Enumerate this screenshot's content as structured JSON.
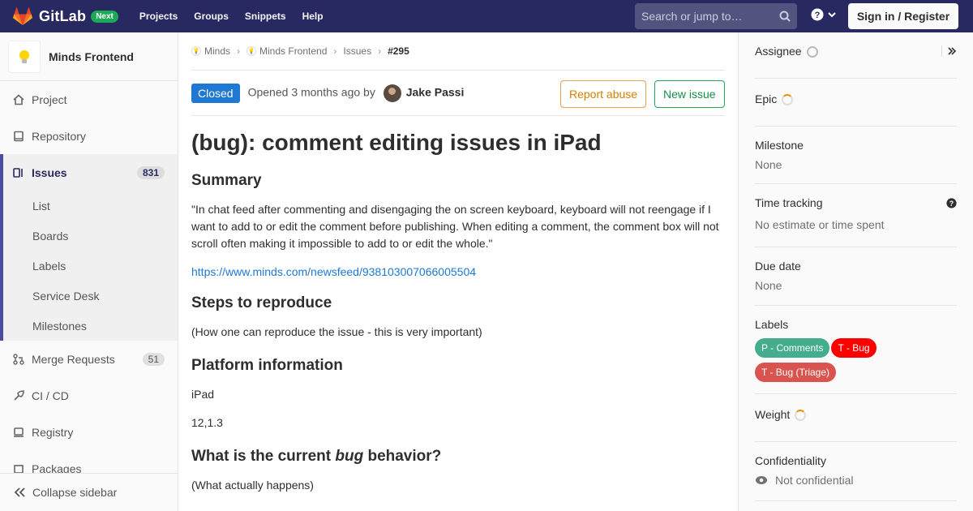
{
  "topbar": {
    "brand": "GitLab",
    "badge": "Next",
    "nav": [
      "Projects",
      "Groups",
      "Snippets",
      "Help"
    ],
    "search_placeholder": "Search or jump to…",
    "signin": "Sign in / Register"
  },
  "sidebar": {
    "project_name": "Minds Frontend",
    "items": [
      {
        "label": "Project",
        "icon": "home-icon"
      },
      {
        "label": "Repository",
        "icon": "book-icon"
      },
      {
        "label": "Issues",
        "icon": "issues-icon",
        "count": "831"
      },
      {
        "label": "Merge Requests",
        "icon": "merge-icon",
        "count": "51"
      },
      {
        "label": "CI / CD",
        "icon": "rocket-icon"
      },
      {
        "label": "Registry",
        "icon": "package-icon"
      },
      {
        "label": "Packages",
        "icon": "box-icon"
      }
    ],
    "issues_sub": [
      "List",
      "Boards",
      "Labels",
      "Service Desk",
      "Milestones"
    ],
    "collapse": "Collapse sidebar"
  },
  "breadcrumb": [
    "Minds",
    "Minds Frontend",
    "Issues",
    "#295"
  ],
  "issue": {
    "status": "Closed",
    "opened_prefix": "Opened",
    "opened_time": "3 months ago",
    "opened_by": "by",
    "author": "Jake Passi",
    "report_abuse": "Report abuse",
    "new_issue": "New issue",
    "title": "(bug): comment editing issues in iPad",
    "summary_heading": "Summary",
    "summary_text": "\"In chat feed after commenting and disengaging the on screen keyboard, keyboard will not reengage if I want to add to or edit the comment before publishing. When editing a comment, the comment box will not scroll often making it impossible to add to or edit the whole.\"",
    "link": "https://www.minds.com/newsfeed/938103007066005504",
    "steps_heading": "Steps to reproduce",
    "steps_text": "(How one can reproduce the issue - this is very important)",
    "platform_heading": "Platform information",
    "platform_device": "iPad",
    "platform_version": "12,1.3",
    "current_heading_pre": "What is the current ",
    "current_heading_em": "bug",
    "current_heading_post": " behavior?",
    "current_text": "(What actually happens)"
  },
  "right_sidebar": {
    "assignee": "Assignee",
    "epic": "Epic",
    "milestone": "Milestone",
    "milestone_value": "None",
    "time_tracking": "Time tracking",
    "time_value": "No estimate or time spent",
    "due_date": "Due date",
    "due_value": "None",
    "labels": "Labels",
    "label_items": [
      {
        "text": "P - Comments",
        "color": "#44ad8e"
      },
      {
        "text": "T - Bug",
        "color": "#ff0000"
      },
      {
        "text": "T - Bug (Triage)",
        "color": "#d9534f"
      }
    ],
    "weight": "Weight",
    "confidentiality": "Confidentiality",
    "confidential_value": "Not confidential"
  },
  "colors": {
    "topbar": "#292961",
    "closed": "#1f78d1",
    "link": "#1f78d1"
  }
}
